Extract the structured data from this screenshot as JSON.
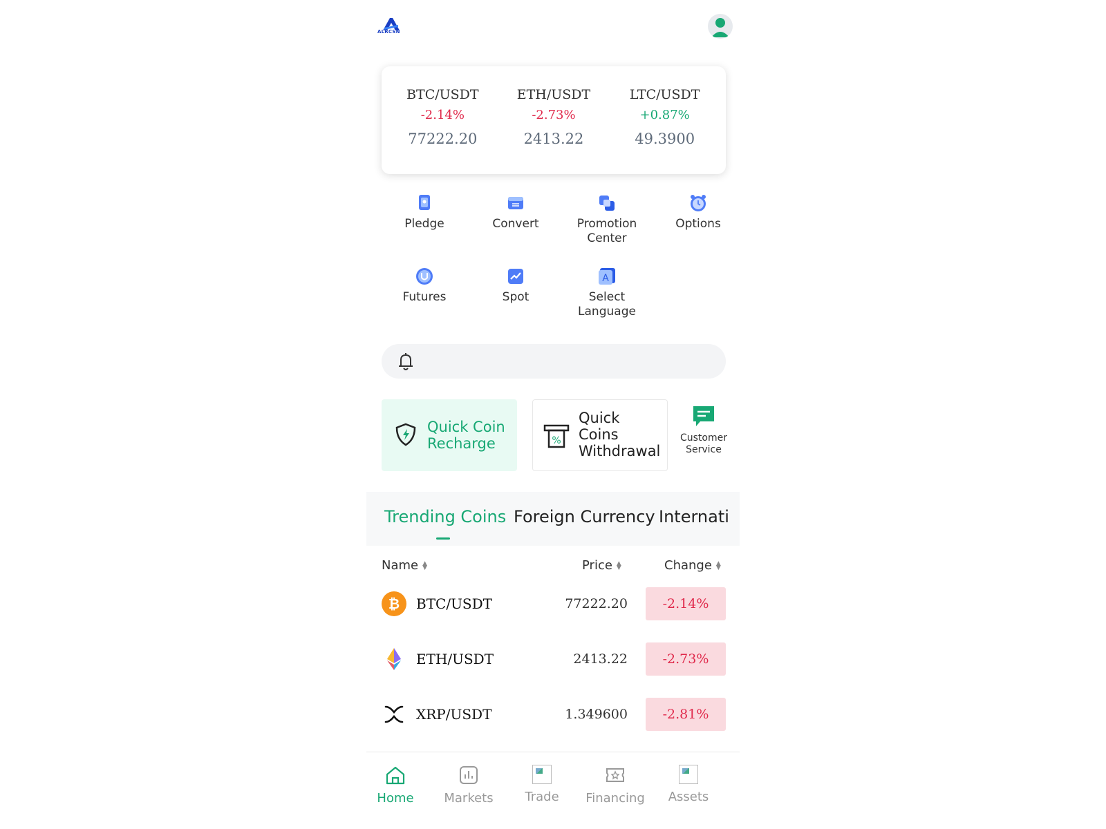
{
  "header": {
    "logo_text": "ALRCSN"
  },
  "tickers": [
    {
      "pair": "BTC/USDT",
      "change": "-2.14%",
      "price": "77222.20"
    },
    {
      "pair": "ETH/USDT",
      "change": "-2.73%",
      "price": "2413.22"
    },
    {
      "pair": "LTC/USDT",
      "change": "+0.87%",
      "price": "49.3900"
    }
  ],
  "menu": [
    {
      "label": "Pledge",
      "icon": "pledge-icon"
    },
    {
      "label": "Convert",
      "icon": "convert-icon"
    },
    {
      "label": "Promotion Center",
      "icon": "promotion-icon"
    },
    {
      "label": "Options",
      "icon": "options-icon"
    },
    {
      "label": "Futures",
      "icon": "futures-icon"
    },
    {
      "label": "Spot",
      "icon": "spot-icon"
    },
    {
      "label": "Select Language",
      "icon": "language-icon"
    }
  ],
  "notice": {
    "icon": "bell-icon"
  },
  "quick_actions": {
    "recharge": "Quick Coin Recharge",
    "withdrawal": "Quick Coins Withdrawal",
    "customer_service": "Customer Service"
  },
  "tabs": [
    "Trending Coins",
    "Foreign Currency",
    "Internati"
  ],
  "table": {
    "headers": {
      "name": "Name",
      "price": "Price",
      "change": "Change"
    },
    "rows": [
      {
        "pair": "BTC/USDT",
        "price": "77222.20",
        "change": "-2.14%",
        "icon": "bitcoin-icon"
      },
      {
        "pair": "ETH/USDT",
        "price": "2413.22",
        "change": "-2.73%",
        "icon": "ethereum-icon"
      },
      {
        "pair": "XRP/USDT",
        "price": "1.349600",
        "change": "-2.81%",
        "icon": "xrp-icon"
      }
    ]
  },
  "bottom_nav": [
    {
      "label": "Home",
      "active": true
    },
    {
      "label": "Markets"
    },
    {
      "label": "Trade"
    },
    {
      "label": "Financing"
    },
    {
      "label": "Assets"
    }
  ],
  "colors": {
    "accent": "#18a874",
    "negative": "#e0294b",
    "negative_bg": "#fadadf",
    "brand": "#1a3fc4"
  }
}
